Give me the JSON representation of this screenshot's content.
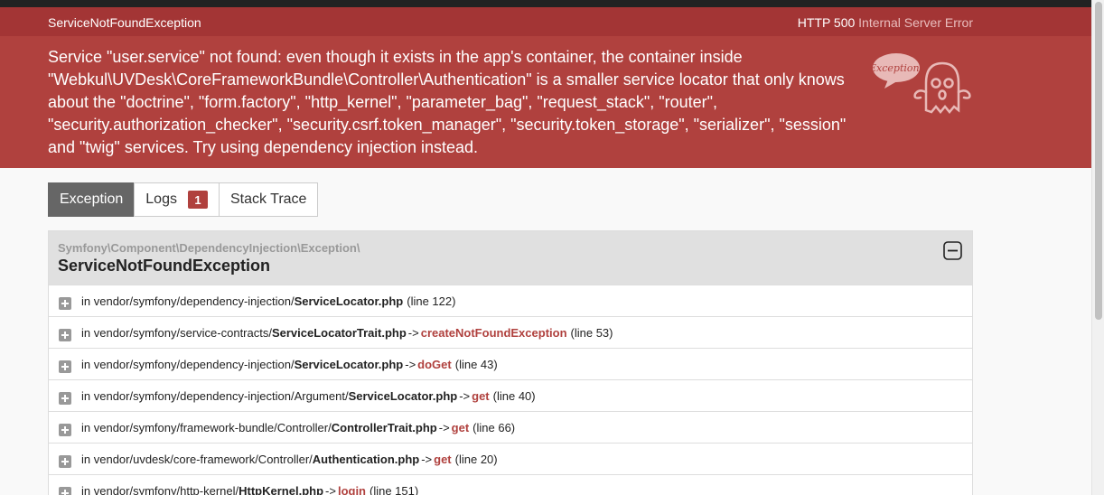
{
  "header": {
    "exception_class": "ServiceNotFoundException",
    "status_code": "HTTP 500",
    "status_text": "Internal Server Error"
  },
  "exception_message": "Service \"user.service\" not found: even though it exists in the app's container, the container inside \"Webkul\\UVDesk\\CoreFrameworkBundle\\Controller\\Authentication\" is a smaller service locator that only knows about the \"doctrine\", \"form.factory\", \"http_kernel\", \"parameter_bag\", \"request_stack\", \"router\", \"security.authorization_checker\", \"security.csrf.token_manager\", \"security.token_storage\", \"serializer\", \"session\" and \"twig\" services. Try using dependency injection instead.",
  "illustration": {
    "label": "Exception!",
    "icon": "ghost-icon"
  },
  "tabs": [
    {
      "label": "Exception",
      "active": true
    },
    {
      "label": "Logs",
      "badge": "1",
      "active": false
    },
    {
      "label": "Stack Trace",
      "active": false
    }
  ],
  "trace": {
    "namespace": "Symfony\\Component\\DependencyInjection\\Exception\\",
    "class": "ServiceNotFoundException",
    "rows": [
      {
        "prefix": "in vendor/symfony/dependency-injection/",
        "file": "ServiceLocator.php",
        "arrow": "",
        "function": "",
        "line": "(line 122)"
      },
      {
        "prefix": "in vendor/symfony/service-contracts/",
        "file": "ServiceLocatorTrait.php",
        "arrow": "->",
        "function": "createNotFoundException",
        "line": "(line 53)"
      },
      {
        "prefix": "in vendor/symfony/dependency-injection/",
        "file": "ServiceLocator.php",
        "arrow": "->",
        "function": "doGet",
        "line": "(line 43)"
      },
      {
        "prefix": "in vendor/symfony/dependency-injection/Argument/",
        "file": "ServiceLocator.php",
        "arrow": "->",
        "function": "get",
        "line": "(line 40)"
      },
      {
        "prefix": "in vendor/symfony/framework-bundle/Controller/",
        "file": "ControllerTrait.php",
        "arrow": "->",
        "function": "get",
        "line": "(line 66)"
      },
      {
        "prefix": "in vendor/uvdesk/core-framework/Controller/",
        "file": "Authentication.php",
        "arrow": "->",
        "function": "get",
        "line": "(line 20)"
      },
      {
        "prefix": "in vendor/symfony/http-kernel/",
        "file": "HttpKernel.php",
        "arrow": "->",
        "function": "login",
        "line": "(line 151)"
      }
    ]
  },
  "colors": {
    "header_bg": "#a33535",
    "message_bg": "#b0413e",
    "accent": "#b0413e",
    "active_tab": "#666666"
  }
}
